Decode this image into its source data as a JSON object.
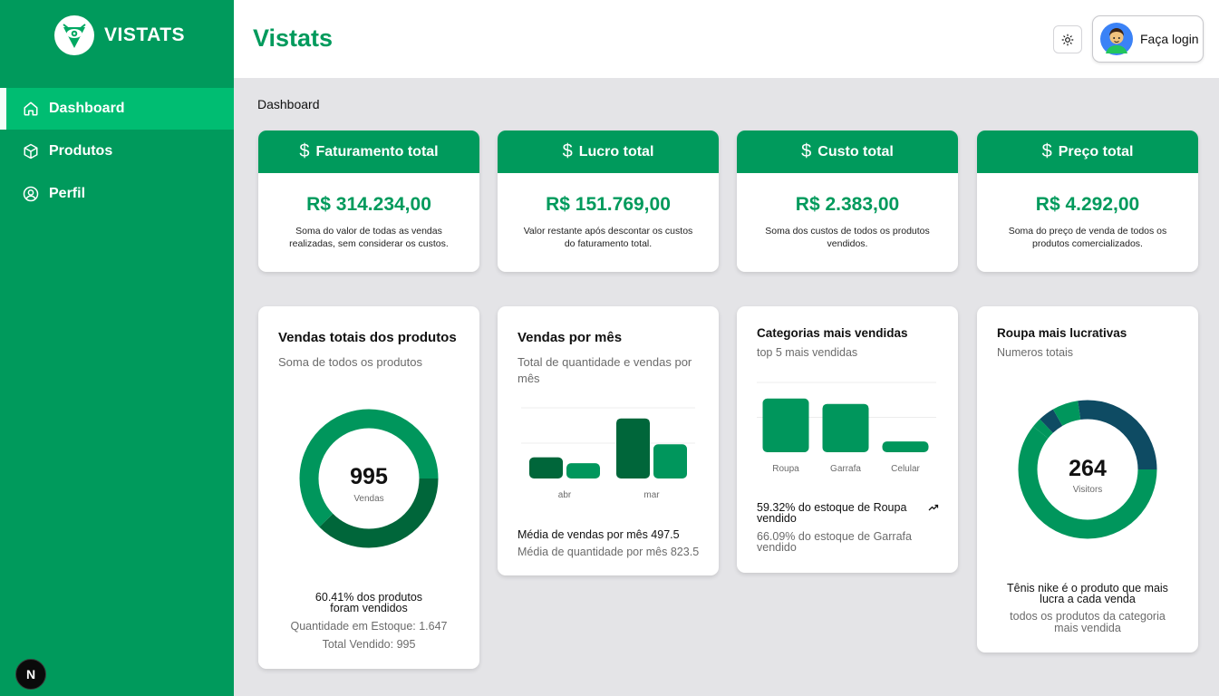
{
  "app": {
    "brand": "VISTATS",
    "page_title": "Vistats",
    "next_badge": "N"
  },
  "sidebar": {
    "items": [
      {
        "label": "Dashboard",
        "icon": "home-icon",
        "active": true
      },
      {
        "label": "Produtos",
        "icon": "box-icon",
        "active": false
      },
      {
        "label": "Perfil",
        "icon": "user-circle-icon",
        "active": false
      }
    ]
  },
  "header": {
    "login_label": "Faça login",
    "theme_icon": "sun-icon"
  },
  "breadcrumb": "Dashboard",
  "kpis": [
    {
      "title": "Faturamento total",
      "value": "R$ 314.234,00",
      "desc": "Soma do valor de todas as vendas realizadas, sem considerar os custos."
    },
    {
      "title": "Lucro total",
      "value": "R$ 151.769,00",
      "desc": "Valor restante após descontar os custos do faturamento total."
    },
    {
      "title": "Custo total",
      "value": "R$ 2.383,00",
      "desc": "Soma dos custos de todos os produtos vendidos."
    },
    {
      "title": "Preço total",
      "value": "R$ 4.292,00",
      "desc": "Soma do preço de venda de todos os produtos comercializados."
    }
  ],
  "cards": {
    "vendas_totais": {
      "title": "Vendas totais dos produtos",
      "subtitle": "Soma de todos os produtos",
      "center_value": "995",
      "center_label": "Vendas",
      "footer_main": "60.41% dos produtos foram vendidos",
      "footer_stock": "Quantidade em Estoque: 1.647",
      "footer_sold": "Total Vendido: 995"
    },
    "vendas_mes": {
      "title": "Vendas por mês",
      "subtitle": "Total de quantidade e vendas por mês",
      "footer_main": "Média de vendas por mês 497.5",
      "footer_sub": "Média de quantidade por mês 823.5"
    },
    "categorias": {
      "title": "Categorias mais vendidas",
      "subtitle": "top 5 mais vendidas",
      "footer_main": "59.32% do estoque de Roupa vendido",
      "footer_sub": "66.09% do estoque de Garrafa vendido",
      "trend_icon": "trending-up-icon"
    },
    "roupa": {
      "title": "Roupa mais lucrativas",
      "subtitle": "Numeros totais",
      "center_value": "264",
      "center_label": "Visitors",
      "footer_main": "Tênis nike é o produto que mais lucra a cada venda",
      "footer_sub": "todos os produtos da categoria mais vendida"
    }
  },
  "chart_data": [
    {
      "type": "pie",
      "variant": "donut",
      "labels": [
        "Vendido",
        "Em estoque"
      ],
      "values": [
        995,
        1647
      ],
      "colors": [
        "#00663a",
        "#00965c"
      ]
    },
    {
      "type": "bar",
      "categories": [
        "abr",
        "mar"
      ],
      "series": [
        {
          "values": [
            180,
            510
          ],
          "color": "#00663a"
        },
        {
          "values": [
            130,
            290
          ],
          "color": "#00965c"
        }
      ],
      "ylim": [
        0,
        600
      ],
      "grid": true
    },
    {
      "type": "bar",
      "categories": [
        "Roupa",
        "Garrafa",
        "Celular"
      ],
      "values": [
        60,
        54,
        12
      ],
      "ylim": [
        0,
        78
      ],
      "color": "#00965c",
      "grid": true
    },
    {
      "type": "pie",
      "variant": "donut",
      "values": [
        160,
        6,
        10,
        16,
        72
      ],
      "colors": [
        "#00965c",
        "#00965c",
        "#0e4b63",
        "#00965c",
        "#0e4b63"
      ]
    }
  ]
}
